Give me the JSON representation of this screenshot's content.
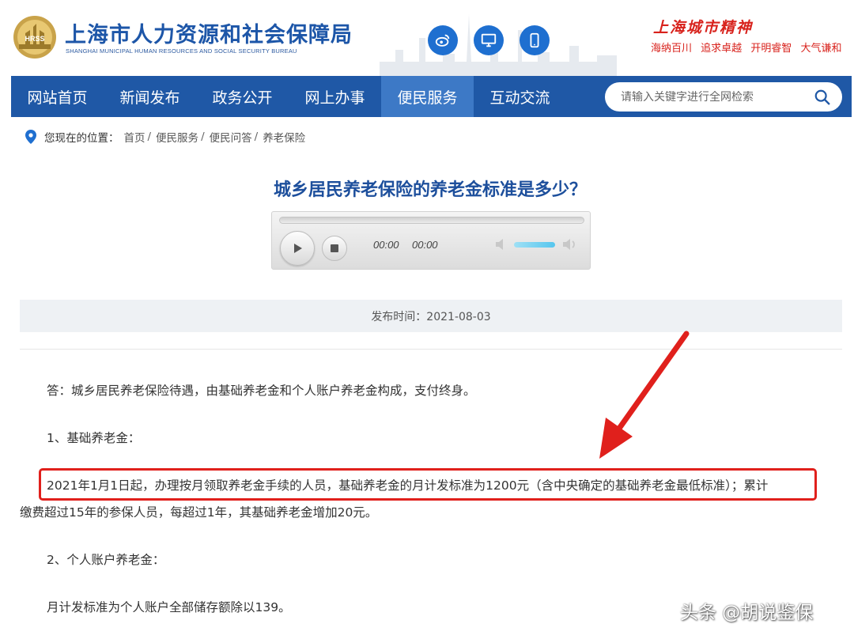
{
  "header": {
    "site_title": "上海市人力资源和社会保障局",
    "site_subtitle": "SHANGHAI MUNICIPAL HUMAN RESOURCES AND SOCIAL SECURITY BUREAU",
    "icons": [
      "weibo-icon",
      "desktop-icon",
      "mobile-icon"
    ],
    "slogan_title": "上海城市精神",
    "slogan_items": [
      "海纳百川",
      "追求卓越",
      "开明睿智",
      "大气谦和"
    ]
  },
  "nav": {
    "items": [
      "网站首页",
      "新闻发布",
      "政务公开",
      "网上办事",
      "便民服务",
      "互动交流"
    ],
    "active_index": 4,
    "search_placeholder": "请输入关键字进行全网检索"
  },
  "breadcrumb": {
    "label": "您现在的位置：",
    "items": [
      "首页",
      "便民服务",
      "便民问答",
      "养老保险"
    ],
    "separator": "/"
  },
  "article": {
    "title": "城乡居民养老保险的养老金标准是多少？",
    "player": {
      "current_time": "00:00",
      "duration": "00:00",
      "progress": 0,
      "volume": 1.0
    },
    "publish_time": "发布时间：2021-08-03",
    "paragraphs": [
      "答：城乡居民养老保险待遇，由基础养老金和个人账户养老金构成，支付终身。",
      "1、基础养老金：",
      "2021年1月1日起，办理按月领取养老金手续的人员，基础养老金的月计发标准为1200元（含中央确定的基础养老金最低标准）；累计",
      "缴费超过15年的参保人员，每超过1年，其基础养老金增加20元。",
      "2、个人账户养老金：",
      "月计发标准为个人账户全部储存额除以139。"
    ]
  },
  "annotation": {
    "highlight_color": "#e0201c",
    "arrow_color": "#e0201c"
  },
  "watermark": "头条 @胡说鉴保",
  "colors": {
    "brand_blue": "#1f58a6",
    "nav_active": "#3d79c6",
    "title_blue": "#1d4f9c",
    "slogan_red": "#d8221c"
  }
}
